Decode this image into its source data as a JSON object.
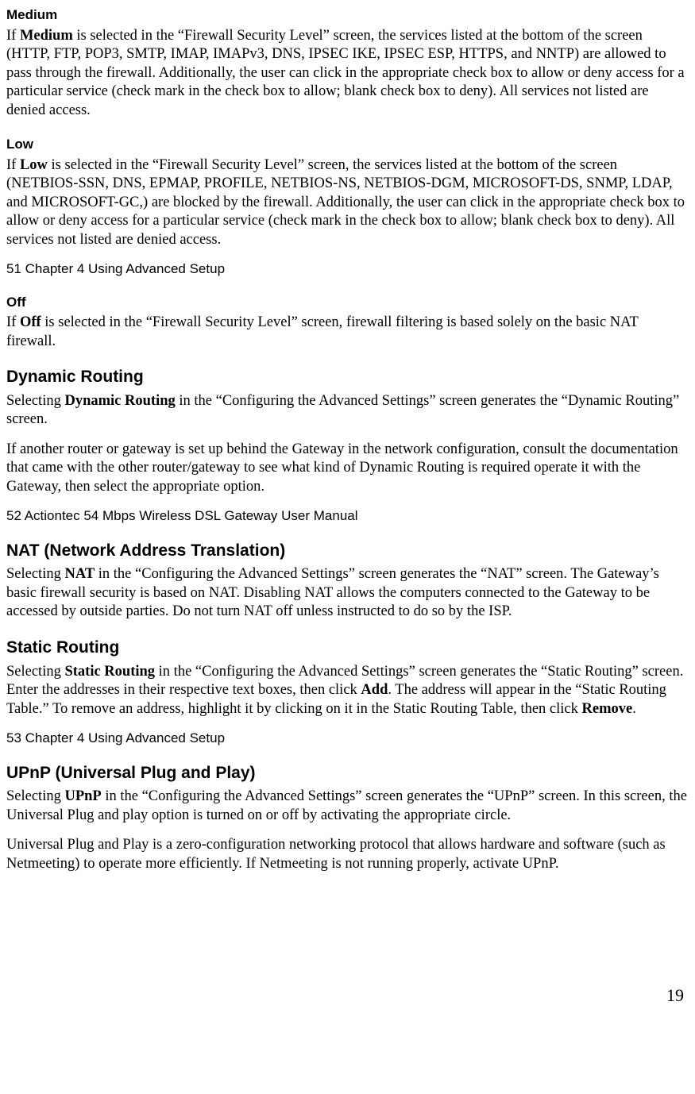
{
  "sections": {
    "medium": {
      "heading": "Medium",
      "body": "If Medium is selected in the \"Firewall Security Level\" screen, the services listed at the bottom of the screen (HTTP, FTP, POP3, SMTP, IMAP, IMAPv3, DNS, IPSEC IKE, IPSEC ESP, HTTPS, and NNTP) are allowed to pass through the firewall. Additionally, the user can click in the appropriate check box to allow or deny access for a particular service (check mark in the check box to allow; blank check box to deny). All services not listed are denied access."
    },
    "low": {
      "heading": "Low",
      "body": "If Low is selected in the \"Firewall Security Level\" screen, the services listed at the bottom of the screen (NETBIOS-SSN, DNS, EPMAP, PROFILE, NETBIOS-NS, NETBIOS-DGM, MICROSOFT-DS, SNMP, LDAP, and MICROSOFT-GC,) are blocked by the firewall. Additionally, the user can click in the appropriate check box to allow or deny access for a particular service (check mark in the check box to allow; blank check box to deny). All services not listed are denied access."
    },
    "off": {
      "heading": "Off",
      "body": "If Off is selected in the \"Firewall Security Level\" screen, firewall filtering is based solely on the basic NAT firewall."
    },
    "dynamic": {
      "heading": "Dynamic Routing",
      "body1": "Selecting Dynamic Routing in the \"Configuring the Advanced Settings\" screen generates the \"Dynamic Routing\" screen.",
      "body2": "If another router or gateway is set up behind the Gateway in the network configuration, consult the documentation that came with the other router/gateway to see what kind of Dynamic Routing is required operate it with the Gateway, then select the appropriate option."
    },
    "nat": {
      "heading": "NAT (Network Address Translation)",
      "body": "Selecting NAT in the \"Configuring the Advanced Settings\" screen generates the \"NAT\" screen. The Gateway's basic firewall security is based on NAT. Disabling NAT allows the computers connected to the Gateway to be accessed by outside parties. Do not turn NAT off unless instructed to do so by the ISP."
    },
    "static": {
      "heading": "Static Routing",
      "body": "Selecting Static Routing in the \"Configuring the Advanced Settings\" screen generates the \"Static Routing\" screen. Enter the addresses in their respective text boxes, then click Add. The address will appear in the \"Static Routing Table.\" To remove an address, highlight it by clicking on it in the Static Routing Table, then click Remove."
    },
    "upnp": {
      "heading": "UPnP (Universal Plug and Play)",
      "body1": "Selecting UPnP in the \"Configuring the Advanced Settings\" screen generates the \"UPnP\" screen. In this screen, the Universal Plug and play option is turned on or off by activating the appropriate circle.",
      "body2": "Universal Plug and Play is a zero-configuration networking protocol that allows hardware and software (such as Netmeeting) to operate more efficiently. If Netmeeting is not running properly, activate UPnP."
    }
  },
  "pagehints": {
    "p51": "51 Chapter 4 Using Advanced Setup",
    "p52": "52 Actiontec 54 Mbps Wireless DSL Gateway User Manual",
    "p53": "53 Chapter 4 Using Advanced Setup"
  },
  "pagenum": "19"
}
